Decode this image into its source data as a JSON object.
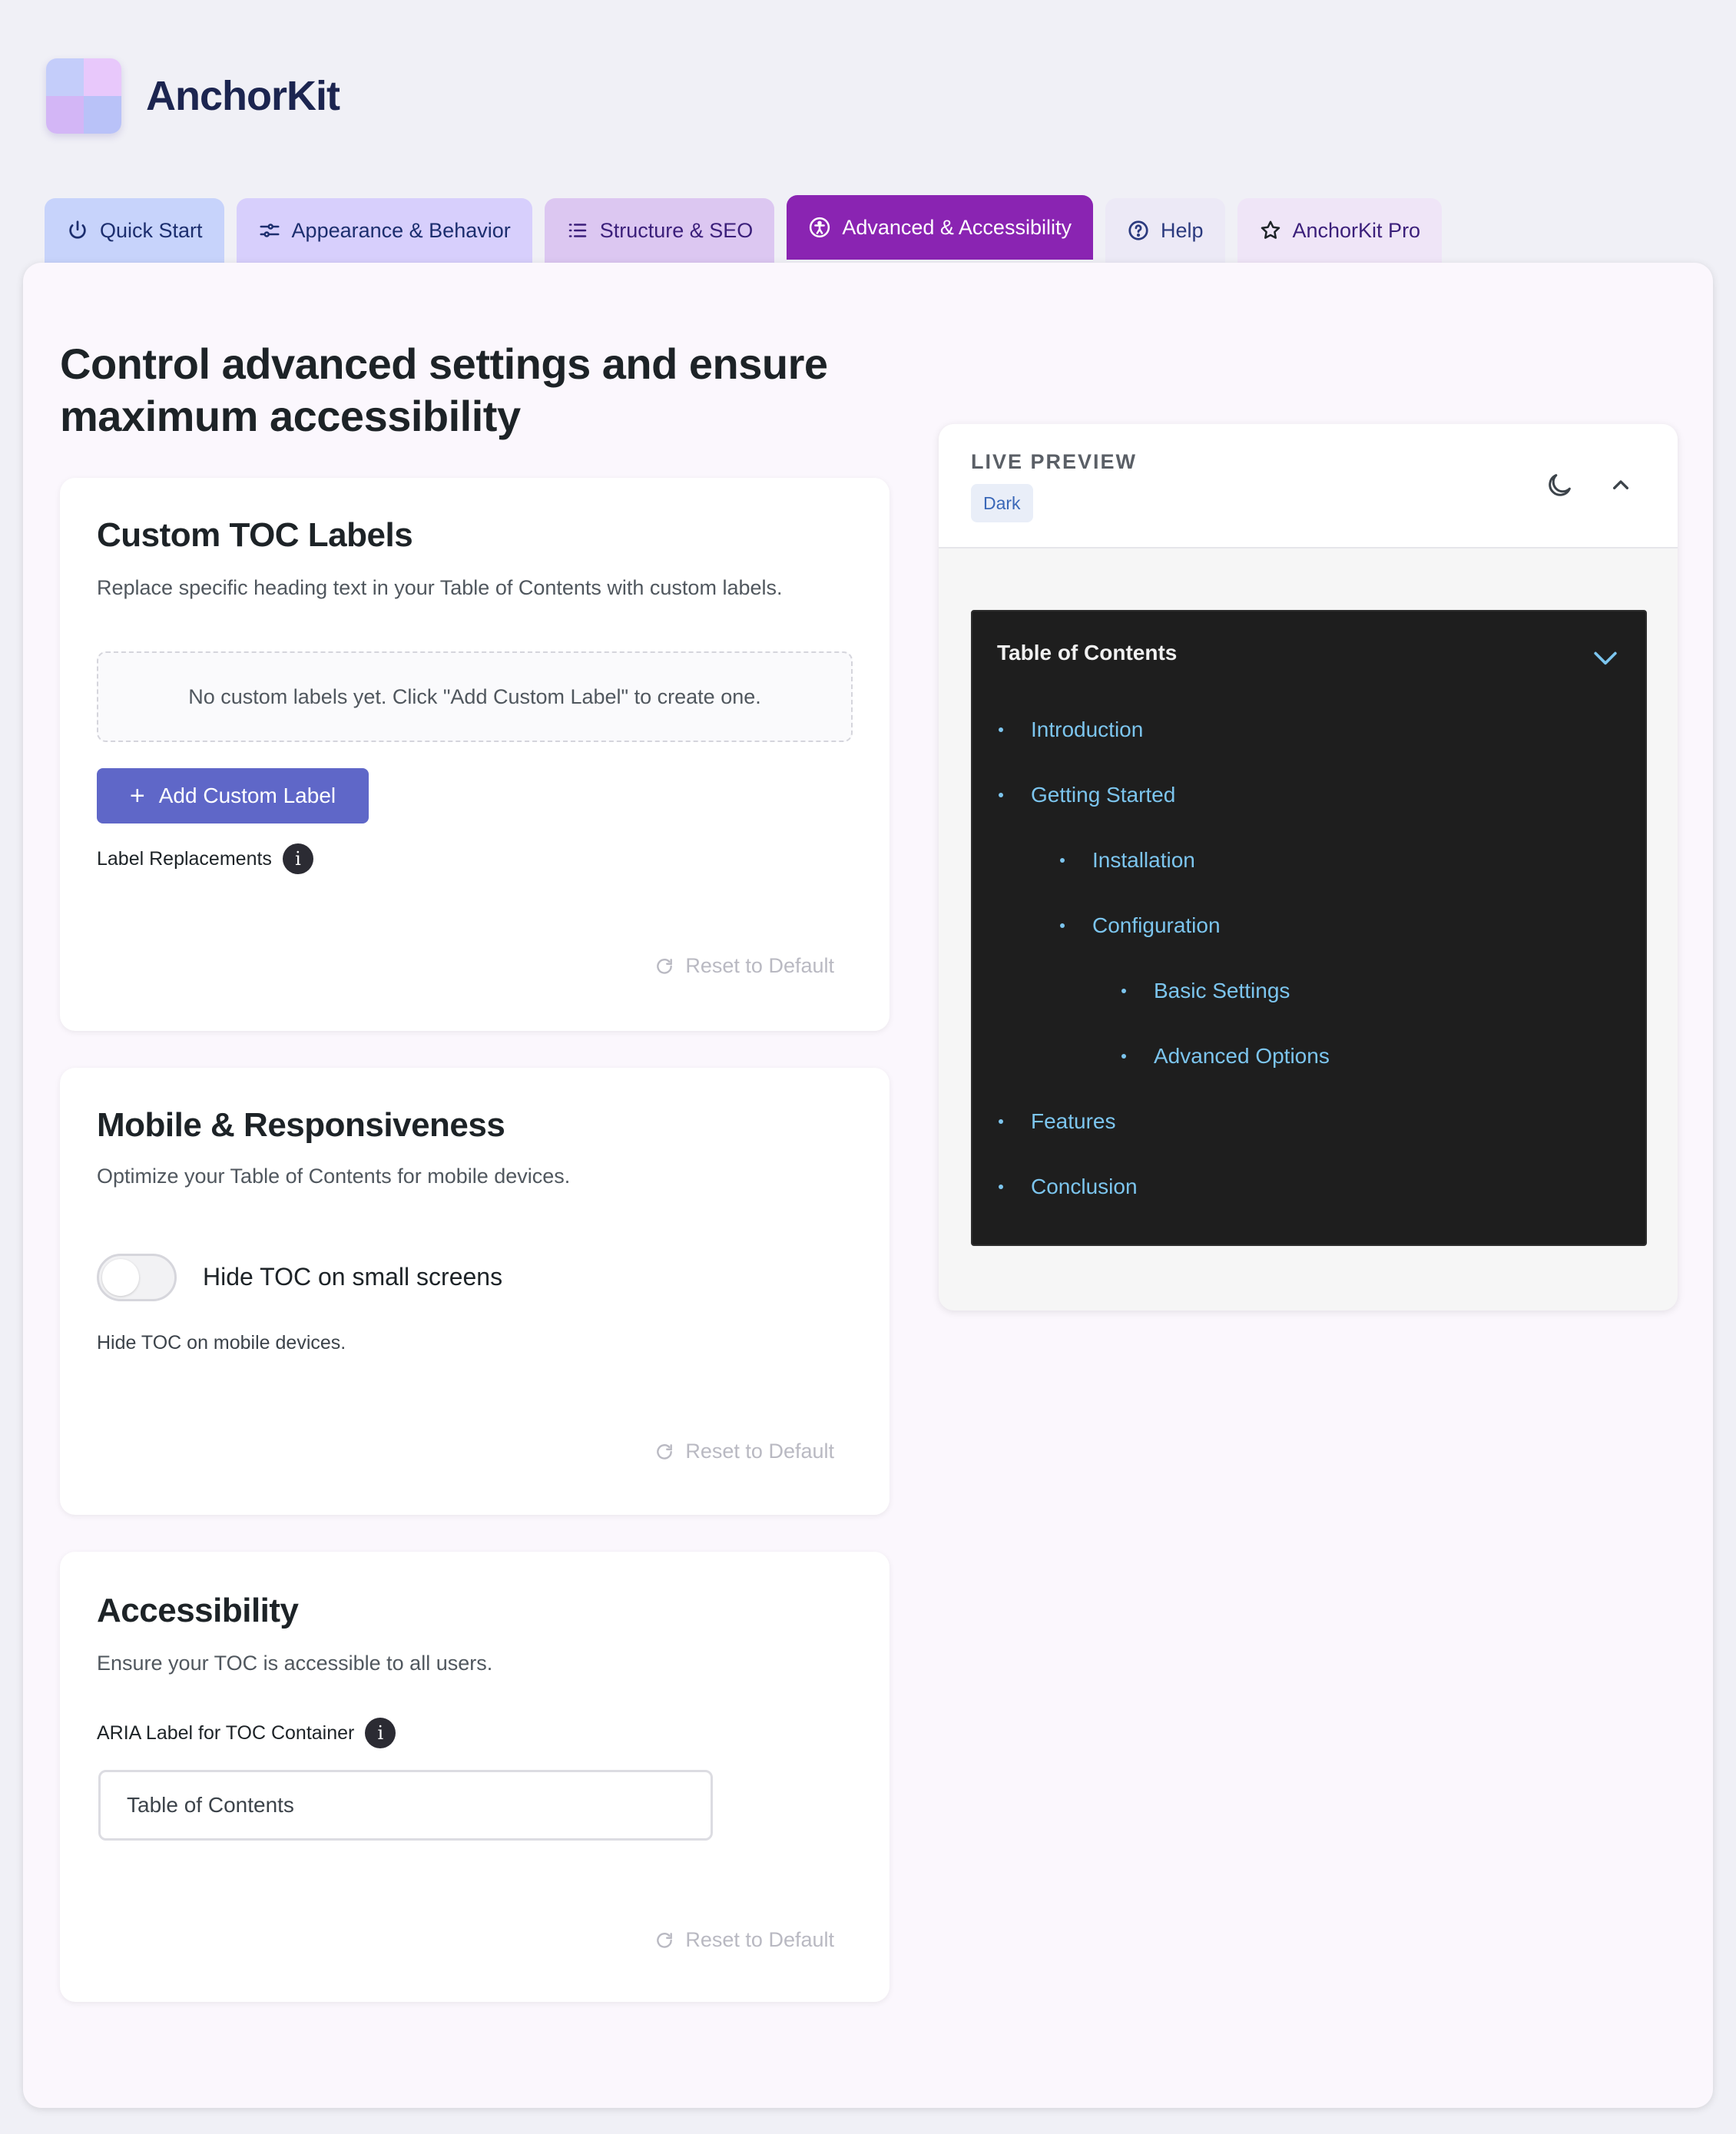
{
  "app": {
    "title": "AnchorKit"
  },
  "tabs": [
    {
      "label": "Quick Start",
      "icon": "power-icon"
    },
    {
      "label": "Appearance & Behavior",
      "icon": "sliders-icon"
    },
    {
      "label": "Structure & SEO",
      "icon": "list-icon"
    },
    {
      "label": "Advanced & Accessibility",
      "icon": "accessibility-icon",
      "active": true
    },
    {
      "label": "Help",
      "icon": "help-circle-icon"
    },
    {
      "label": "AnchorKit Pro",
      "icon": "star-icon"
    }
  ],
  "page": {
    "title": "Control advanced settings and ensure maximum accessibility"
  },
  "custom_labels": {
    "title": "Custom TOC Labels",
    "description": "Replace specific heading text in your Table of Contents with custom labels.",
    "empty_message": "No custom labels yet. Click \"Add Custom Label\" to create one.",
    "add_button": "Add Custom Label",
    "field_label": "Label Replacements",
    "reset": "Reset to Default"
  },
  "mobile": {
    "title": "Mobile & Responsiveness",
    "description": "Optimize your Table of Contents for mobile devices.",
    "toggle_label": "Hide TOC on small screens",
    "toggle_on": false,
    "help": "Hide TOC on mobile devices.",
    "reset": "Reset to Default"
  },
  "accessibility": {
    "title": "Accessibility",
    "description": "Ensure your TOC is accessible to all users.",
    "field_label": "ARIA Label for TOC Container",
    "input_value": "Table of Contents",
    "reset": "Reset to Default"
  },
  "preview": {
    "title": "LIVE PREVIEW",
    "badge": "Dark",
    "toc_title": "Table of Contents",
    "items": [
      {
        "label": "Introduction",
        "level": 1
      },
      {
        "label": "Getting Started",
        "level": 1
      },
      {
        "label": "Installation",
        "level": 2
      },
      {
        "label": "Configuration",
        "level": 2
      },
      {
        "label": "Basic Settings",
        "level": 3
      },
      {
        "label": "Advanced Options",
        "level": 3
      },
      {
        "label": "Features",
        "level": 1
      },
      {
        "label": "Conclusion",
        "level": 1
      }
    ]
  },
  "colors": {
    "active_tab": "#8a24b2",
    "primary_button": "#5f67c8",
    "toc_background": "#1e1e1e",
    "toc_link": "#7cc5ee"
  }
}
